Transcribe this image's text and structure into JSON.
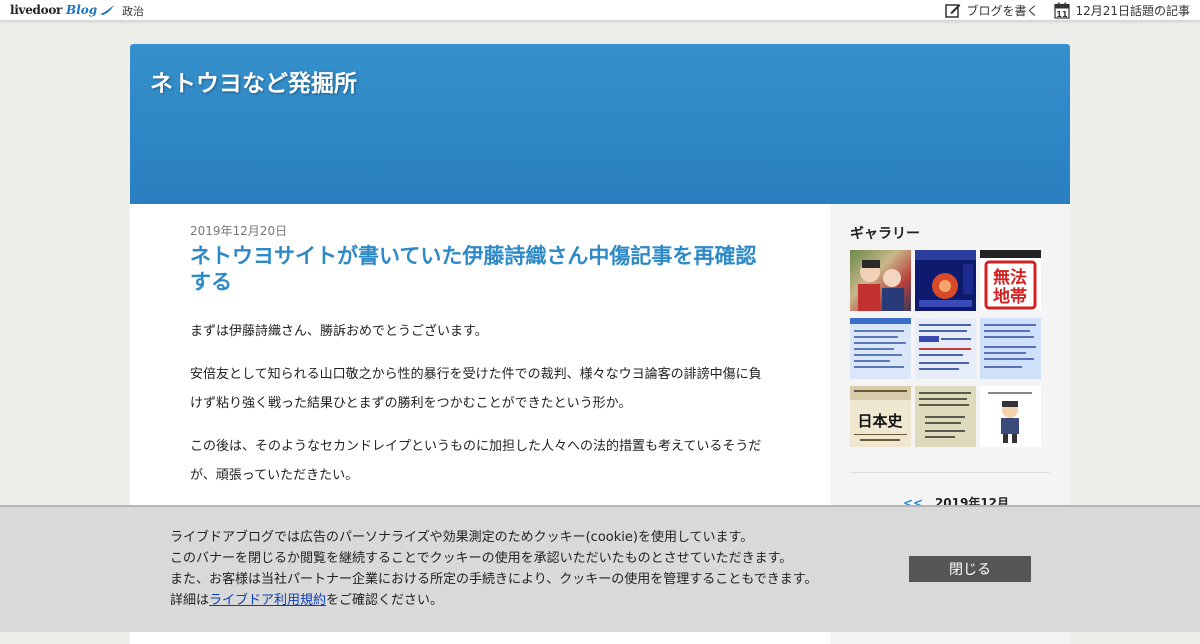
{
  "topbar": {
    "logo_text": "livedoor",
    "logo_blog": "Blog",
    "category_link": "政治",
    "write_blog": "ブログを書く",
    "calendar_day": "11",
    "topic_articles": "12月21日話題の記事"
  },
  "header": {
    "blog_title": "ネトウヨなど発掘所",
    "color": "#2e8ac7"
  },
  "article": {
    "date": "2019年12月20日",
    "title": "ネトウヨサイトが書いていた伊藤詩織さん中傷記事を再確認する",
    "paragraphs": [
      "まずは伊藤詩織さん、勝訴おめでとうございます。",
      "安倍友として知られる山口敬之から性的暴行を受けた件での裁判、様々なウヨ論客の誹謗中傷に負けず粘り強く戦った結果ひとまずの勝利をつかむことができたという形か。",
      "この後は、そのようなセカンドレイプというものに加担した人々への法的措置も考えているそうだが、頑張っていただきたい。"
    ]
  },
  "sidebar": {
    "gallery_title": "ギャラリー",
    "gallery_thumb_1_1": "無法",
    "gallery_thumb_1_2": "地帯",
    "gallery_thumb_2_2_text": "日本史",
    "calendar_prev": "<<",
    "calendar_month": "2019年12月"
  },
  "cookie_banner": {
    "line1": "ライブドアブログでは広告のパーソナライズや効果測定のためクッキー(cookie)を使用しています。",
    "line2": "このバナーを閉じるか閲覧を継続することでクッキーの使用を承認いただいたものとさせていただきます。",
    "line3": "また、お客様は当社パートナー企業における所定の手続きにより、クッキーの使用を管理することもできます。",
    "line4_prefix": "詳細は",
    "line4_link": "ライブドア利用規約",
    "line4_suffix": "をご確認ください。",
    "close_button": "閉じる"
  }
}
